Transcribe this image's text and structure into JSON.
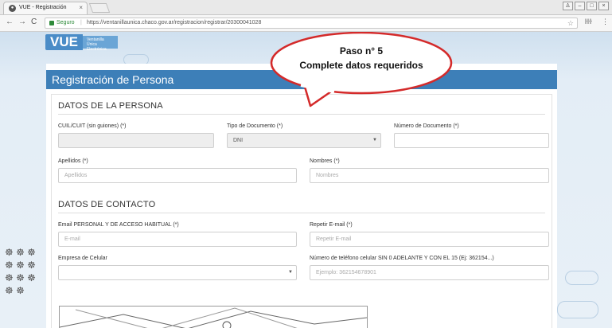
{
  "browser": {
    "tab_title": "VUE - Registración",
    "tab_close": "×",
    "secure_label": "Seguro",
    "url": "https://ventanillaunica.chaco.gov.ar/registracion/registrar/20300041028",
    "back": "←",
    "forward": "→",
    "reload": "C",
    "star": "☆",
    "menu": "⋮",
    "ext_label": "ŀŀŀ"
  },
  "logo": {
    "text": "VUE",
    "sub_line1": "Ventanilla",
    "sub_line2": "Única Electrónica"
  },
  "callout": {
    "line1": "Paso n° 5",
    "line2": "Complete datos requeridos",
    "color": "#d42a2a"
  },
  "header": {
    "title": "Registración de Persona",
    "color": "#3d7fb8"
  },
  "sections": {
    "persona": {
      "title": "DATOS DE LA PERSONA",
      "cuil_label": "CUIL/CUIT (sin guiones) (*)",
      "cuil_value": "",
      "tipo_label": "Tipo de Documento (*)",
      "tipo_value": "DNI",
      "numero_label": "Número de Documento (*)",
      "numero_value": "",
      "apellidos_label": "Apellidos (*)",
      "apellidos_placeholder": "Apellidos",
      "nombres_label": "Nombres (*)",
      "nombres_placeholder": "Nombres"
    },
    "contacto": {
      "title": "DATOS DE CONTACTO",
      "email_label": "Email PERSONAL Y DE ACCESO HABITUAL (*)",
      "email_placeholder": "E-mail",
      "repetir_label": "Repetir E-mail (*)",
      "repetir_placeholder": "Repetir E-mail",
      "empresa_label": "Empresa de Celular",
      "empresa_value": "",
      "telefono_label": "Número de teléfono celular SIN 0 ADELANTE Y CON EL 15 (Ej: 362154...)",
      "telefono_placeholder": "Ejemplo: 362154678901"
    }
  }
}
